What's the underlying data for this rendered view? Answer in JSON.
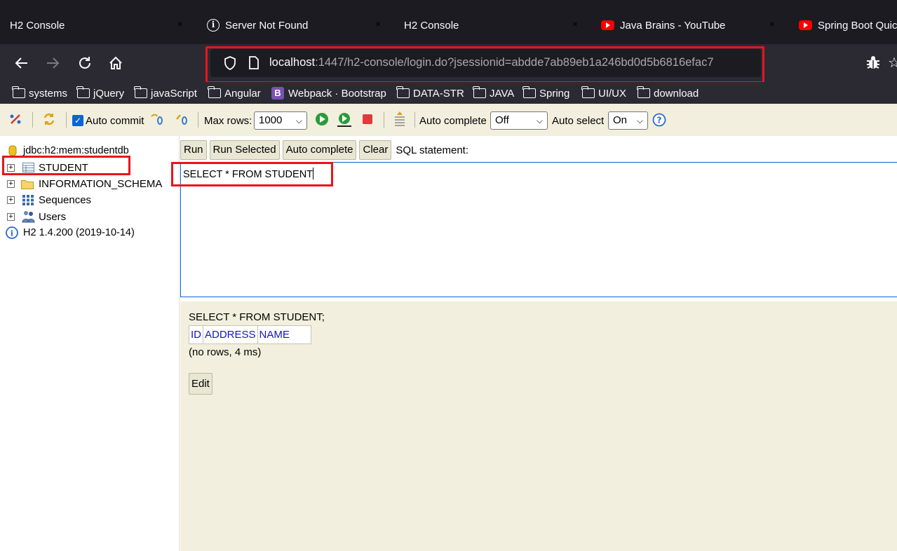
{
  "tabs": [
    {
      "title": "H2 Console",
      "icon": "none"
    },
    {
      "title": "Server Not Found",
      "icon": "info-icon"
    },
    {
      "title": "H2 Console",
      "icon": "none"
    },
    {
      "title": "Java Brains - YouTube",
      "icon": "youtube-icon"
    },
    {
      "title": "Spring Boot Quic",
      "icon": "youtube-icon"
    }
  ],
  "tab_close_glyph": "×",
  "url": {
    "host": "localhost",
    "rest": ":1447/h2-console/login.do?jsessionid=abdde7ab89eb1a246bd0d5b6816efac7"
  },
  "bookmarks": [
    {
      "label": "systems",
      "icon": "folder-icon"
    },
    {
      "label": "jQuery",
      "icon": "folder-icon"
    },
    {
      "label": "javaScript",
      "icon": "folder-icon"
    },
    {
      "label": "Angular",
      "icon": "folder-icon"
    },
    {
      "label": "Webpack · Bootstrap",
      "icon": "bootstrap-icon"
    },
    {
      "label": "DATA-STR",
      "icon": "folder-icon"
    },
    {
      "label": "JAVA",
      "icon": "folder-icon"
    },
    {
      "label": "Spring",
      "icon": "folder-icon"
    },
    {
      "label": "UI/UX",
      "icon": "folder-icon"
    },
    {
      "label": "download",
      "icon": "folder-icon"
    }
  ],
  "bootstrap_letter": "B",
  "toolbar": {
    "auto_commit_label": "Auto commit",
    "auto_commit_checked": true,
    "max_rows_label": "Max rows:",
    "max_rows_value": "1000",
    "auto_complete_label": "Auto complete",
    "auto_complete_value": "Off",
    "auto_select_label": "Auto select",
    "auto_select_value": "On"
  },
  "tree": {
    "connection": "jdbc:h2:mem:studentdb",
    "items": [
      {
        "label": "STUDENT",
        "icon": "table-icon"
      },
      {
        "label": "INFORMATION_SCHEMA",
        "icon": "folder-icon"
      },
      {
        "label": "Sequences",
        "icon": "sequences-icon"
      },
      {
        "label": "Users",
        "icon": "users-icon"
      }
    ],
    "version": "H2 1.4.200 (2019-10-14)"
  },
  "sql": {
    "buttons": {
      "run": "Run",
      "run_selected": "Run Selected",
      "auto_complete": "Auto complete",
      "clear": "Clear"
    },
    "statement_label": "SQL statement:",
    "editor_text": "SELECT * FROM STUDENT"
  },
  "results": {
    "statement": "SELECT * FROM STUDENT;",
    "columns": [
      "ID",
      "ADDRESS",
      "NAME"
    ],
    "info": "(no rows, 4 ms)",
    "edit_label": "Edit"
  },
  "colors": {
    "highlight": "#e8141c",
    "h2_background": "#f2efde",
    "link_blue": "#1414c8"
  }
}
